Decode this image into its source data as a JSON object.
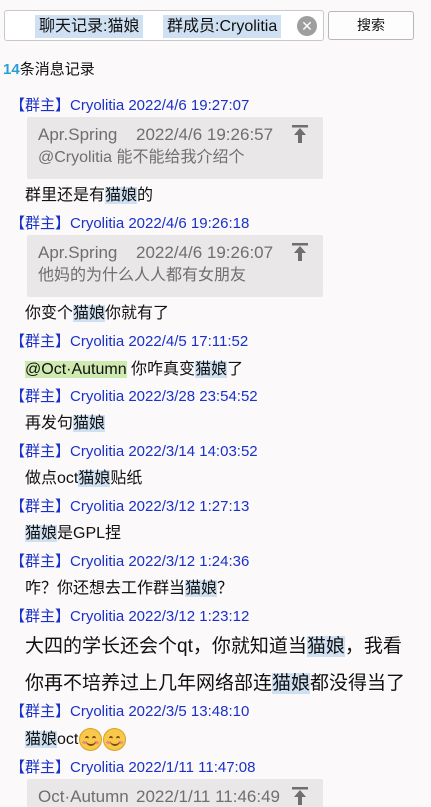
{
  "search": {
    "chips": [
      "聊天记录:猫娘",
      "群成员:Cryolitia"
    ],
    "button_label": "搜索"
  },
  "summary": {
    "count": "14",
    "suffix": "条消息记录"
  },
  "records": [
    {
      "header": "【群主】Cryolitia 2022/4/6 19:27:07",
      "quote": {
        "author": "Apr.Spring",
        "time": "2022/4/6 19:26:57",
        "text": "@Cryolitia 能不能给我介绍个"
      },
      "message": [
        {
          "t": "群里还是有"
        },
        {
          "t": "猫娘",
          "hl": true
        },
        {
          "t": "的"
        }
      ]
    },
    {
      "header": "【群主】Cryolitia 2022/4/6 19:26:18",
      "quote": {
        "author": "Apr.Spring",
        "time": "2022/4/6 19:26:07",
        "text": "他妈的为什么人人都有女朋友"
      },
      "message": [
        {
          "t": "你变个"
        },
        {
          "t": "猫娘",
          "hl": true
        },
        {
          "t": "你就有了"
        }
      ]
    },
    {
      "header": "【群主】Cryolitia 2022/4/5 17:11:52",
      "message": [
        {
          "t": "@Oct·Autumn",
          "mention": true
        },
        {
          "t": " 你咋真变"
        },
        {
          "t": "猫娘",
          "hl": true
        },
        {
          "t": "了"
        }
      ]
    },
    {
      "header": "【群主】Cryolitia 2022/3/28 23:54:52",
      "message": [
        {
          "t": "再发句"
        },
        {
          "t": "猫娘",
          "hl": true
        }
      ]
    },
    {
      "header": "【群主】Cryolitia 2022/3/14 14:03:52",
      "message": [
        {
          "t": "做点oct"
        },
        {
          "t": "猫娘",
          "hl": true
        },
        {
          "t": "贴纸"
        }
      ]
    },
    {
      "header": "【群主】Cryolitia 2022/3/12 1:27:13",
      "message": [
        {
          "t": "猫娘",
          "hl": true
        },
        {
          "t": "是GPL捏"
        }
      ]
    },
    {
      "header": "【群主】Cryolitia 2022/3/12 1:24:36",
      "message": [
        {
          "t": "咋？你还想去工作群当"
        },
        {
          "t": "猫娘",
          "hl": true
        },
        {
          "t": "？"
        }
      ]
    },
    {
      "header": "【群主】Cryolitia 2022/3/12 1:23:12",
      "message_lines": [
        [
          {
            "t": "大四的学长还会个qt，你就知道当"
          },
          {
            "t": "猫娘",
            "hl": true
          },
          {
            "t": "，我看"
          }
        ],
        [
          {
            "t": "你再不培养过上几年网络部连"
          },
          {
            "t": "猫娘",
            "hl": true
          },
          {
            "t": "都没得当了"
          }
        ]
      ]
    },
    {
      "header": "【群主】Cryolitia 2022/3/5 13:48:10",
      "message": [
        {
          "t": "猫娘",
          "hl": true
        },
        {
          "t": "oct"
        },
        {
          "emoji": "blush-smile"
        },
        {
          "emoji": "blush-smile"
        }
      ]
    },
    {
      "header": "【群主】Cryolitia 2022/1/11 11:47:08",
      "quote": {
        "author": "Oct·Autumn",
        "time": "2022/1/11 11:46:49",
        "text": ""
      }
    }
  ],
  "icons": {
    "pin": "pin-icon",
    "clear": "clear-icon",
    "emoji": "blush-smile-emoji"
  },
  "colors": {
    "header": "#1a31c9",
    "highlight": "#cfe0f2",
    "mention": "#cfeab0",
    "count": "#2a9fd6"
  }
}
